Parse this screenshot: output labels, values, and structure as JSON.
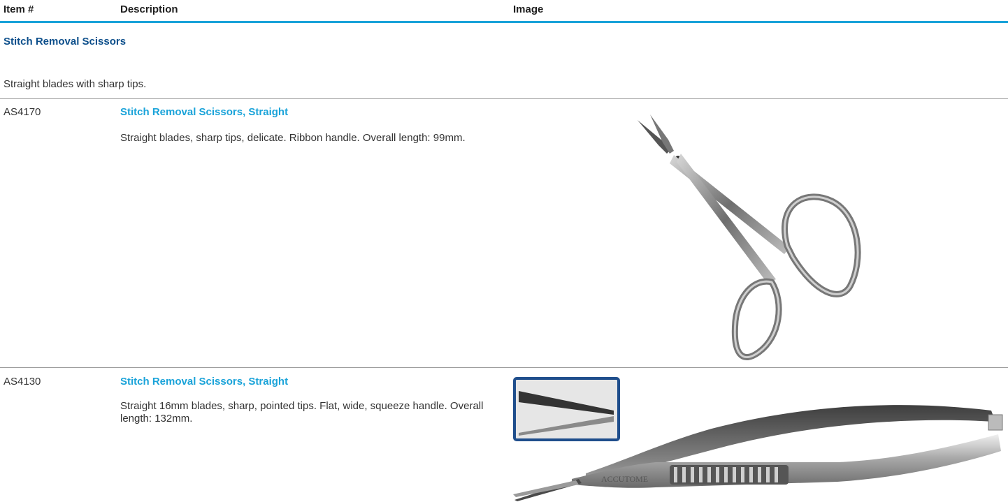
{
  "header": {
    "item_col": "Item #",
    "description_col": "Description",
    "image_col": "Image"
  },
  "section": {
    "title": "Stitch Removal Scissors",
    "description": "Straight blades with sharp tips."
  },
  "items": [
    {
      "item_number": "AS4170",
      "title": "Stitch Removal Scissors, Straight",
      "description": "Straight blades, sharp tips, delicate. Ribbon handle. Overall length: 99mm.",
      "image_icon": "ribbon-handle-scissors"
    },
    {
      "item_number": "AS4130",
      "title": "Stitch Removal Scissors, Straight",
      "description": "Straight 16mm blades, sharp, pointed tips. Flat, wide, squeeze handle. Overall length: 132mm.",
      "image_icon": "squeeze-handle-scissors",
      "image_brand": "ACCUTOME"
    }
  ],
  "colors": {
    "accent": "#1aa3d9",
    "section_title": "#0d4f8b",
    "text": "#333333",
    "inset_frame": "#1f4e8c"
  }
}
